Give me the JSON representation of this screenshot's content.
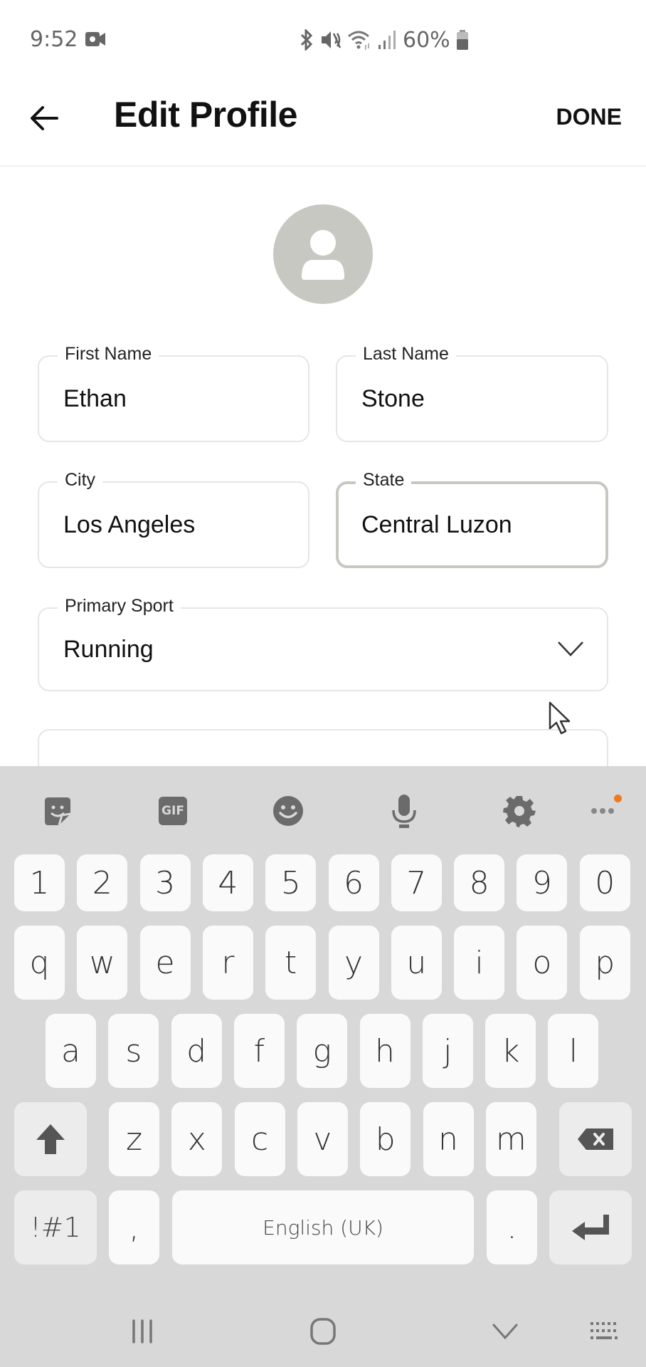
{
  "status_bar": {
    "time": "9:52",
    "left_icons": [
      "screen-record-icon"
    ],
    "right_icons": [
      "bluetooth-icon",
      "mute-icon",
      "wifi-icon",
      "signal-icon"
    ],
    "battery_percent": "60%",
    "battery_level": 0.6
  },
  "app_bar": {
    "back_icon": "arrow-left-icon",
    "title": "Edit Profile",
    "done_label": "DONE"
  },
  "avatar": {
    "icon": "person-icon",
    "color": "#c8c8c2"
  },
  "form": {
    "first_name": {
      "label": "First Name",
      "value": "Ethan"
    },
    "last_name": {
      "label": "Last Name",
      "value": "Stone"
    },
    "city": {
      "label": "City",
      "value": "Los Angeles"
    },
    "state": {
      "label": "State",
      "value": "Central Luzon",
      "focused": true
    },
    "primary_sport": {
      "label": "Primary Sport",
      "value": "Running",
      "icon": "chevron-down-icon"
    }
  },
  "keyboard": {
    "toolbar": [
      {
        "name": "sticker-icon"
      },
      {
        "name": "gif-icon",
        "label": "GIF"
      },
      {
        "name": "emoji-icon"
      },
      {
        "name": "microphone-icon"
      },
      {
        "name": "settings-gear-icon"
      },
      {
        "name": "more-options-icon",
        "badge_color": "#f07a1e"
      }
    ],
    "rows": [
      [
        "1",
        "2",
        "3",
        "4",
        "5",
        "6",
        "7",
        "8",
        "9",
        "0"
      ],
      [
        "q",
        "w",
        "e",
        "r",
        "t",
        "y",
        "u",
        "i",
        "o",
        "p"
      ],
      [
        "a",
        "s",
        "d",
        "f",
        "g",
        "h",
        "j",
        "k",
        "l"
      ],
      [
        "shift",
        "z",
        "x",
        "c",
        "v",
        "b",
        "n",
        "m",
        "backspace"
      ],
      [
        "!#1",
        ",",
        "English (UK)",
        ".",
        "enter"
      ]
    ],
    "space_label": "English (UK)",
    "symbols_label": "!#1",
    "comma_label": ",",
    "period_label": "."
  },
  "nav_bar": {
    "buttons": [
      "recent-apps-icon",
      "home-icon",
      "hide-keyboard-icon",
      "keyboard-switch-icon"
    ]
  },
  "colors": {
    "keyboard_bg": "#d8d8d8",
    "key_bg": "#fafafa",
    "field_border": "#e6e6e2",
    "focused_border": "#c8c8c2"
  }
}
